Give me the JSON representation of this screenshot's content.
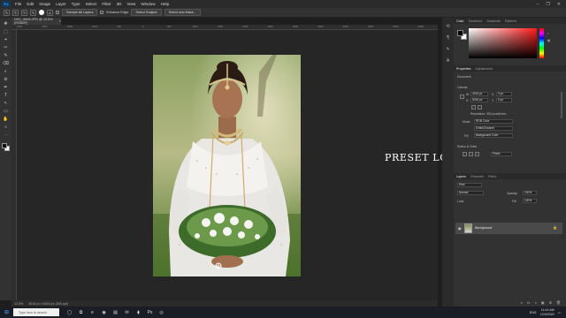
{
  "app": {
    "logo": "Ps",
    "menu": [
      "File",
      "Edit",
      "Image",
      "Layer",
      "Type",
      "Select",
      "Filter",
      "3D",
      "View",
      "Window",
      "Help"
    ],
    "window_controls": [
      "–",
      "❐",
      "✕"
    ]
  },
  "options_bar": {
    "sample_all_layers": "Sample All Layers",
    "enhance_edge": "Enhance Edge",
    "select_subject": "Select Subject",
    "select_and_mask": "Select and Mask..."
  },
  "document": {
    "tab_title": "DSC_9648.JPG @ 12.5% (RGB/8*)",
    "close": "×"
  },
  "ruler_ticks": [
    "2500",
    "2000",
    "1500",
    "1000",
    "500",
    "0",
    "500",
    "1000",
    "1500",
    "2000",
    "2500",
    "3000",
    "3500",
    "4000",
    "4500",
    "5000",
    "5500"
  ],
  "toolbar": {
    "tools": [
      "✥",
      "⬚",
      "⌖",
      "✂",
      "✎",
      "⌫",
      "◐",
      "⊘",
      "✒",
      "T",
      "↖",
      "▭",
      "✋",
      "⌕",
      "⋯"
    ]
  },
  "canvas": {
    "watermark": "PRESET  LOKKA"
  },
  "status_bar": {
    "zoom": "12.5%",
    "info": "4016 px x 6016 px (300 ppi)"
  },
  "color_panel": {
    "tabs": [
      "Color",
      "Swatches",
      "Gradients",
      "Patterns"
    ],
    "accent_colors": {
      "hue": "#ff2020"
    }
  },
  "properties_panel": {
    "tabs": [
      "Properties",
      "Adjustments"
    ],
    "document_label": "Document",
    "canvas_label": "Canvas",
    "w_label": "W",
    "h_label": "H",
    "w_value": "4016 px",
    "h_value": "6016 px",
    "x_label": "X",
    "y_label": "Y",
    "x_value": "0 px",
    "y_value": "0 px",
    "resolution": "Resolution: 300 pixels/inch",
    "mode_label": "Mode",
    "mode_value": "RGB Color",
    "depth_value": "8 Bits/Channel",
    "fill_label": "Fill",
    "fill_value": "Background Color",
    "rulers_label": "Rulers & Grids",
    "units_value": "Pixels"
  },
  "layers_panel": {
    "tabs": [
      "Layers",
      "Channels",
      "Paths"
    ],
    "kind_label": "Kind",
    "blend_mode": "Normal",
    "opacity_label": "Opacity:",
    "opacity_value": "100%",
    "lock_label": "Lock:",
    "fill_label": "Fill:",
    "fill_value": "100%",
    "layer_name": "Background",
    "bottom_icons": [
      "∞",
      "fx",
      "◑",
      "▣",
      "⊞",
      "🗑"
    ]
  },
  "taskbar": {
    "search_placeholder": "Type here to search",
    "icons": [
      "◯",
      "⧉",
      "e",
      "◉",
      "▤",
      "✉",
      "⧫",
      "Ps",
      "◎"
    ],
    "time": "11:04 AM",
    "date": "12/4/2020",
    "lang": "ENG"
  }
}
